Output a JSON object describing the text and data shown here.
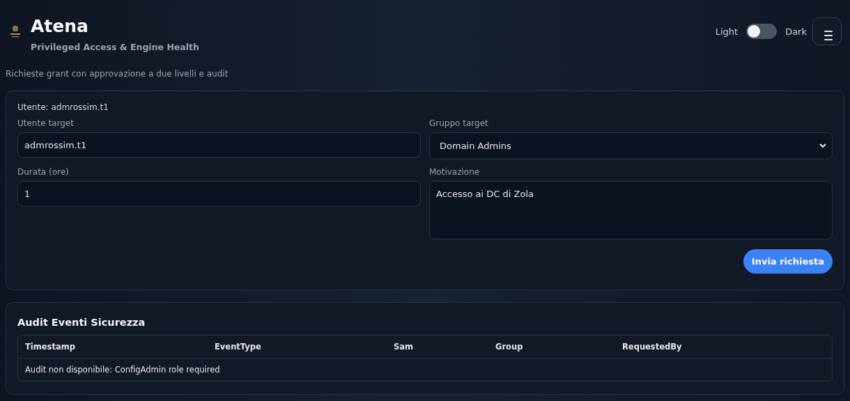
{
  "header": {
    "title": "Atena",
    "subtitle": "Privileged Access & Engine Health",
    "theme_toggle": {
      "label_left": "Light",
      "label_right": "Dark",
      "on": false
    }
  },
  "page_description": "Richieste grant con approvazione a due livelli e audit",
  "request_form": {
    "current_user": "Utente: admrossim.t1",
    "fields": [
      {
        "kind": "input",
        "label": "Utente target",
        "value": "admrossim.t1"
      },
      {
        "kind": "select",
        "label": "Gruppo target",
        "value": "Domain Admins"
      },
      {
        "kind": "input",
        "label": "Durata (ore)",
        "value": "1"
      },
      {
        "kind": "textarea",
        "label": "Motivazione",
        "value": "Accesso ai DC di Zola"
      }
    ],
    "submit_button": "Invia richiesta"
  },
  "audit": {
    "title": "Audit Eventi Sicurezza",
    "columns": [
      "Timestamp",
      "EventType",
      "Sam",
      "Group",
      "RequestedBy"
    ],
    "message": "Audit non disponibile: ConfigAdmin role required"
  }
}
